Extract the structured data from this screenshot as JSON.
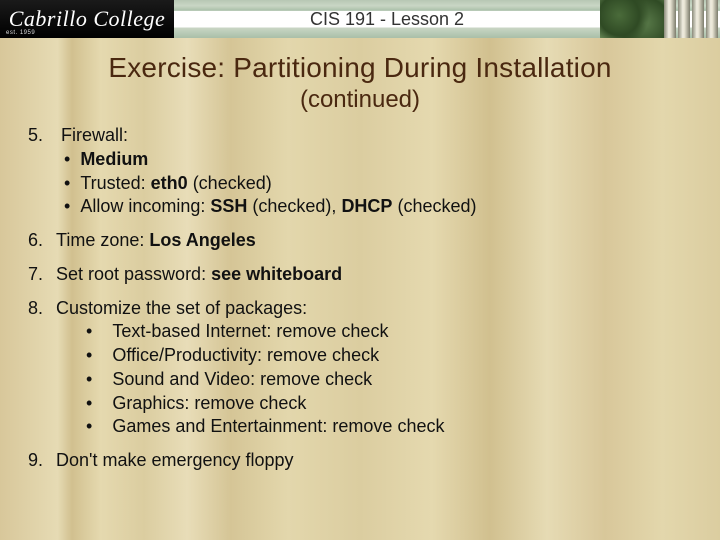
{
  "header": {
    "logo_text": "Cabrillo College",
    "logo_est": "est. 1959",
    "course": "CIS 191 - Lesson 2"
  },
  "title": "Exercise: Partitioning During Installation",
  "subtitle": "(continued)",
  "items": {
    "i5": {
      "num": "5.",
      "label": "Firewall:",
      "b1_bold": "Medium",
      "b2_pre": "Trusted: ",
      "b2_bold": "eth0",
      "b2_post": " (checked)",
      "b3_pre": "Allow incoming: ",
      "b3_bold1": "SSH",
      "b3_mid": " (checked), ",
      "b3_bold2": "DHCP",
      "b3_post": " (checked)"
    },
    "i6": {
      "num": "6.",
      "pre": "Time zone:  ",
      "bold": "Los Angeles"
    },
    "i7": {
      "num": "7.",
      "pre": "Set root password:  ",
      "bold": "see whiteboard"
    },
    "i8": {
      "num": "8.",
      "label": "Customize the set of packages:",
      "b1": "Text-based Internet:  remove check",
      "b2": "Office/Productivity:  remove check",
      "b3": "Sound and Video: remove check",
      "b4": "Graphics: remove check",
      "b5": "Games and Entertainment: remove check"
    },
    "i9": {
      "num": "9.",
      "text": "Don't make emergency floppy"
    }
  }
}
